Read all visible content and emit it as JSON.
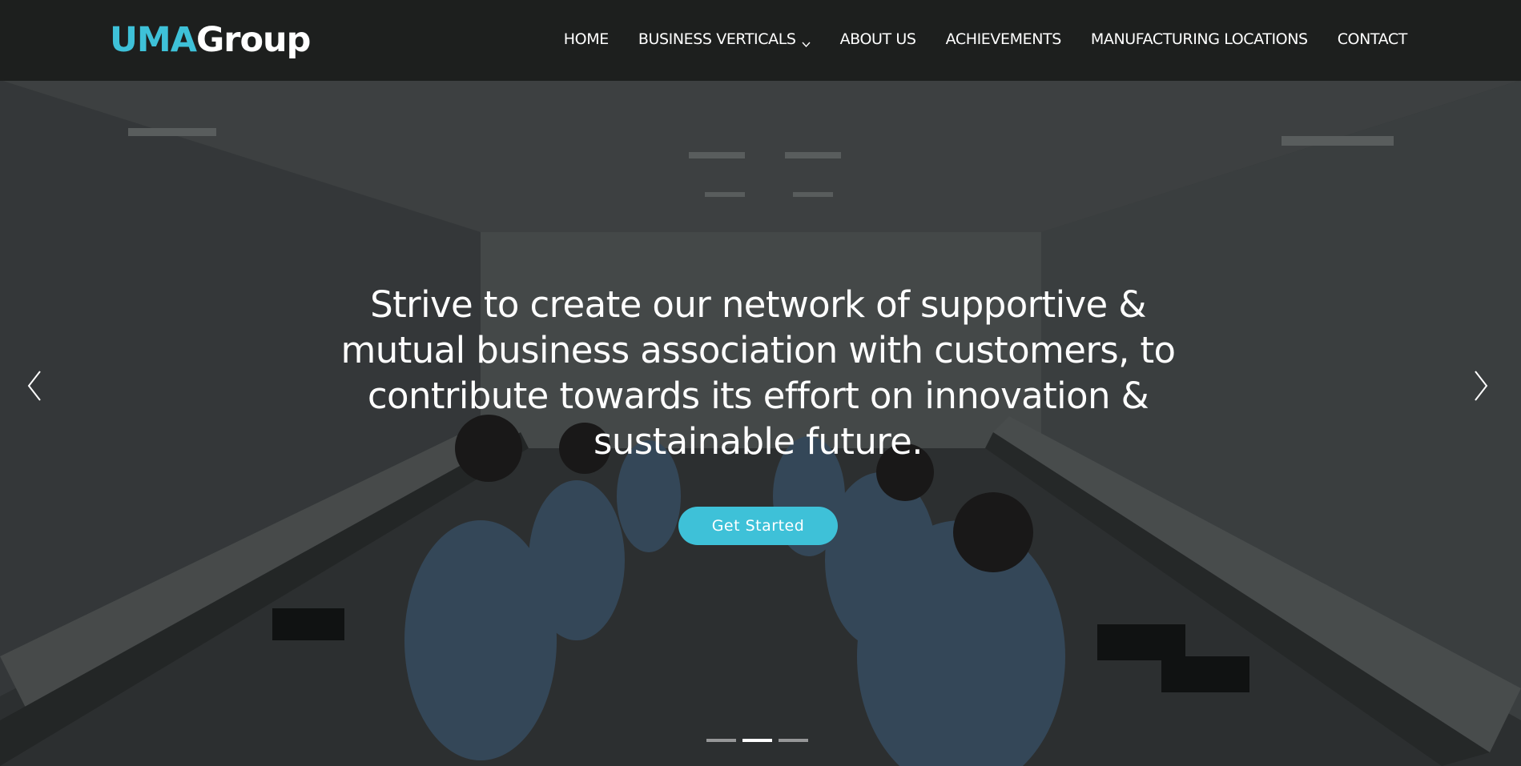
{
  "brand": {
    "logo_part1": "UMA",
    "logo_part2": "Group",
    "accent_color": "#3ec1d8"
  },
  "nav": {
    "items": [
      {
        "label": "HOME"
      },
      {
        "label": "BUSINESS VERTICALS",
        "icon": "chevron-down-icon"
      },
      {
        "label": "ABOUT US"
      },
      {
        "label": "ACHIEVEMENTS"
      },
      {
        "label": "MANUFACTURING LOCATIONS"
      },
      {
        "label": "CONTACT"
      }
    ]
  },
  "hero": {
    "headline": "Strive to create our network of supportive & mutual business association with customers, to contribute towards its effort on innovation & sustainable future.",
    "cta_label": "Get Started",
    "prev_icon": "chevron-left-icon",
    "next_icon": "chevron-right-icon",
    "slides_total": 3,
    "active_slide": 2
  }
}
